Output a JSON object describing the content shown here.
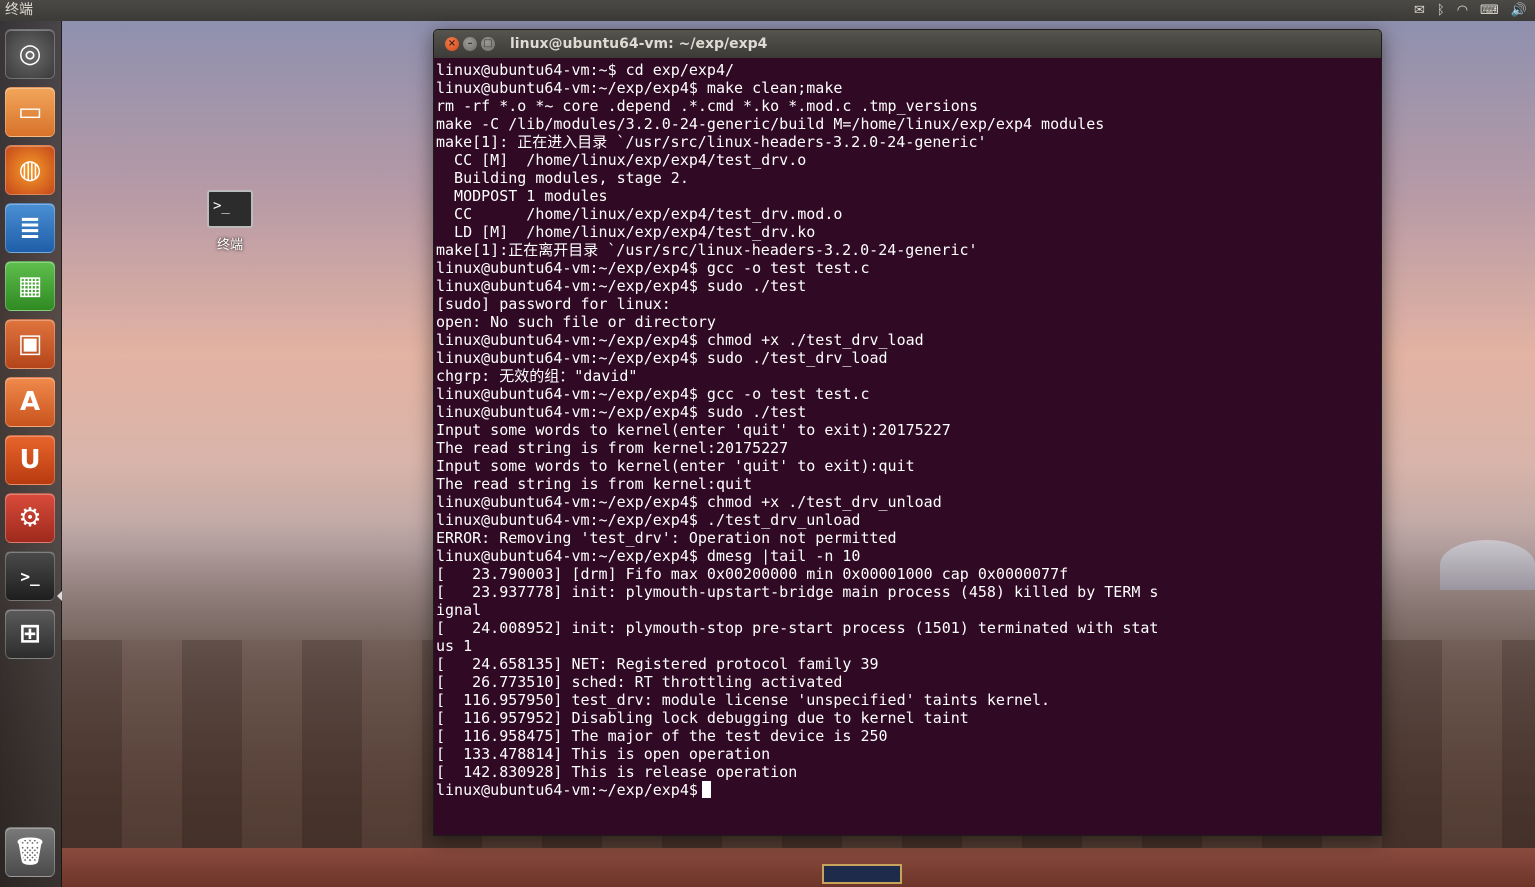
{
  "top_panel": {
    "app_title": "终端",
    "tray_icons": [
      "mail-icon",
      "bluetooth-icon",
      "wifi-icon",
      "keyboard-icon",
      "volume-icon"
    ]
  },
  "launcher": {
    "items": [
      {
        "name": "dash-home",
        "icon": "ubuntu-logo-icon"
      },
      {
        "name": "files",
        "icon": "folder-icon"
      },
      {
        "name": "firefox",
        "icon": "firefox-icon"
      },
      {
        "name": "libreoffice-writer",
        "icon": "writer-icon"
      },
      {
        "name": "libreoffice-calc",
        "icon": "calc-icon"
      },
      {
        "name": "libreoffice-impress",
        "icon": "impress-icon"
      },
      {
        "name": "software-center",
        "icon": "software-center-icon"
      },
      {
        "name": "ubuntu-one",
        "icon": "ubuntu-one-icon"
      },
      {
        "name": "system-settings",
        "icon": "settings-icon"
      },
      {
        "name": "terminal",
        "icon": "terminal-icon"
      },
      {
        "name": "workspace-switcher",
        "icon": "workspace-icon"
      },
      {
        "name": "trash",
        "icon": "trash-icon"
      }
    ]
  },
  "desktop_icon": {
    "label": "终端",
    "glyph": ">_"
  },
  "terminal": {
    "title": "linux@ubuntu64-vm: ~/exp/exp4",
    "close_glyph": "×",
    "min_glyph": "–",
    "max_glyph": "□",
    "lines": [
      "linux@ubuntu64-vm:~$ cd exp/exp4/",
      "linux@ubuntu64-vm:~/exp/exp4$ make clean;make",
      "rm -rf *.o *~ core .depend .*.cmd *.ko *.mod.c .tmp_versions",
      "make -C /lib/modules/3.2.0-24-generic/build M=/home/linux/exp/exp4 modules",
      "make[1]: 正在进入目录 `/usr/src/linux-headers-3.2.0-24-generic'",
      "  CC [M]  /home/linux/exp/exp4/test_drv.o",
      "  Building modules, stage 2.",
      "  MODPOST 1 modules",
      "  CC      /home/linux/exp/exp4/test_drv.mod.o",
      "  LD [M]  /home/linux/exp/exp4/test_drv.ko",
      "make[1]:正在离开目录 `/usr/src/linux-headers-3.2.0-24-generic'",
      "linux@ubuntu64-vm:~/exp/exp4$ gcc -o test test.c",
      "linux@ubuntu64-vm:~/exp/exp4$ sudo ./test",
      "[sudo] password for linux:",
      "open: No such file or directory",
      "linux@ubuntu64-vm:~/exp/exp4$ chmod +x ./test_drv_load",
      "linux@ubuntu64-vm:~/exp/exp4$ sudo ./test_drv_load",
      "chgrp: 无效的组：\"david\"",
      "linux@ubuntu64-vm:~/exp/exp4$ gcc -o test test.c",
      "linux@ubuntu64-vm:~/exp/exp4$ sudo ./test",
      "Input some words to kernel(enter 'quit' to exit):20175227",
      "The read string is from kernel:20175227",
      "Input some words to kernel(enter 'quit' to exit):quit",
      "The read string is from kernel:quit",
      "linux@ubuntu64-vm:~/exp/exp4$ chmod +x ./test_drv_unload",
      "linux@ubuntu64-vm:~/exp/exp4$ ./test_drv_unload",
      "ERROR: Removing 'test_drv': Operation not permitted",
      "linux@ubuntu64-vm:~/exp/exp4$ dmesg |tail -n 10",
      "[   23.790003] [drm] Fifo max 0x00200000 min 0x00001000 cap 0x0000077f",
      "[   23.937778] init: plymouth-upstart-bridge main process (458) killed by TERM s",
      "ignal",
      "[   24.008952] init: plymouth-stop pre-start process (1501) terminated with stat",
      "us 1",
      "[   24.658135] NET: Registered protocol family 39",
      "[   26.773510] sched: RT throttling activated",
      "[  116.957950] test_drv: module license 'unspecified' taints kernel.",
      "[  116.957952] Disabling lock debugging due to kernel taint",
      "[  116.958475] The major of the test device is 250",
      "[  133.478814] This is open operation",
      "[  142.830928] This is release operation"
    ],
    "prompt": "linux@ubuntu64-vm:~/exp/exp4$"
  },
  "colors": {
    "terminal_bg": "#300a24",
    "terminal_fg": "#ffffff",
    "panel_bg": "#3c3b37",
    "close_button": "#e25822"
  }
}
